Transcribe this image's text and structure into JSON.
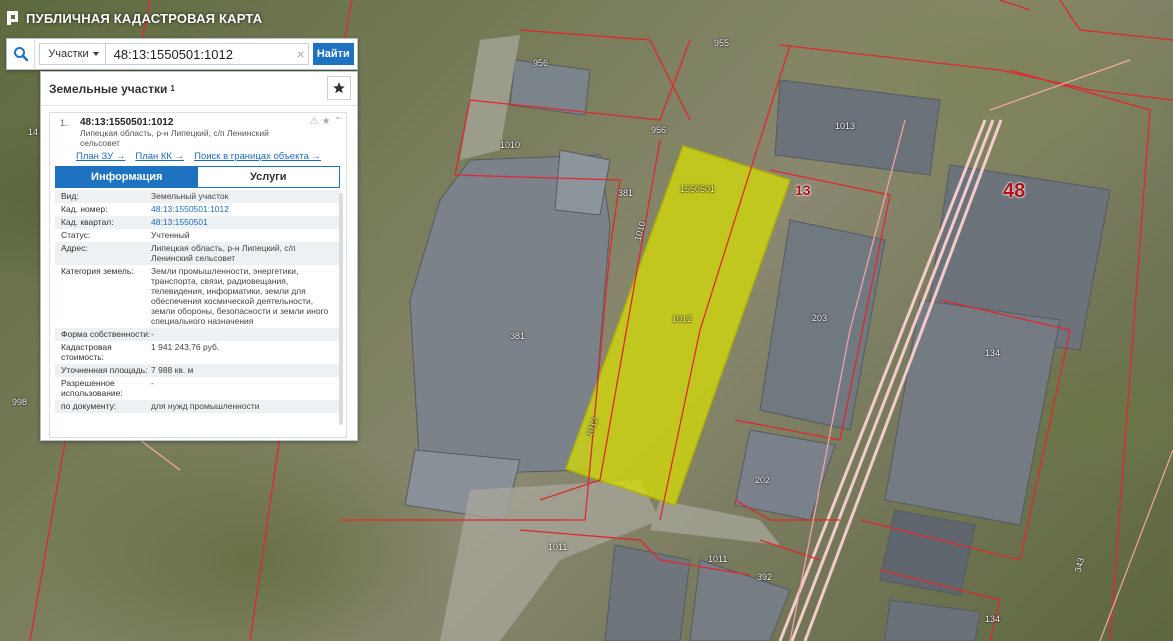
{
  "app": {
    "title": "ПУБЛИЧНАЯ КАДАСТРОВАЯ КАРТА",
    "logo_icon": "map-logo-icon"
  },
  "search": {
    "type_label": "Участки",
    "query": "48:13:1550501:1012",
    "find_label": "Найти"
  },
  "panel": {
    "title": "Земельные участки",
    "count": "1",
    "result": {
      "index": "1.",
      "cad_number": "48:13:1550501:1012",
      "address": "Липецкая область, р-н Липецкий, с/п Ленинский сельсовет",
      "links": [
        "План ЗУ →",
        "План КК →",
        "Поиск в границах объекта →"
      ],
      "tabs": {
        "info": "Информация",
        "services": "Услуги"
      },
      "rows": [
        {
          "key": "Вид:",
          "value": "Земельный участок"
        },
        {
          "key": "Кад. номер:",
          "value": "48:13:1550501:1012"
        },
        {
          "key": "Кад. квартал:",
          "value": "48:13:1550501"
        },
        {
          "key": "Статус:",
          "value": "Учтенный"
        },
        {
          "key": "Адрес:",
          "value": "Липецкая область, р-н Липецкий, с/п Ленинский сельсовет"
        },
        {
          "key": "Категория земель:",
          "value": "Земли промышленности, энергетики, транспорта, связи, радиовещания, телевидения, информатики, земли для обеспечения космической деятельности, земли обороны, безопасности и земли иного специального назначения"
        },
        {
          "key": "Форма собственности:",
          "value": "-"
        },
        {
          "key": "Кадастровая стоимость:",
          "value": "1 941 243,76 руб."
        },
        {
          "key": "Уточненная площадь:",
          "value": "7 988 кв. м"
        },
        {
          "key": "Разрешенное использование:",
          "value": "-"
        },
        {
          "key": "по документу:",
          "value": "для нужд промышленности"
        }
      ]
    }
  },
  "map": {
    "parcel_labels": [
      "955",
      "956",
      "956",
      "1010",
      "1013",
      "381",
      "381",
      "1550501",
      "1012",
      "1012",
      "1010",
      "203",
      "134",
      "202",
      "1011",
      "1011",
      "392",
      "134",
      "998",
      "14",
      "343"
    ],
    "quarter_labels": [
      "13",
      "48"
    ],
    "highlight_color": "#d8e000",
    "boundary_color": "#e0282e"
  }
}
